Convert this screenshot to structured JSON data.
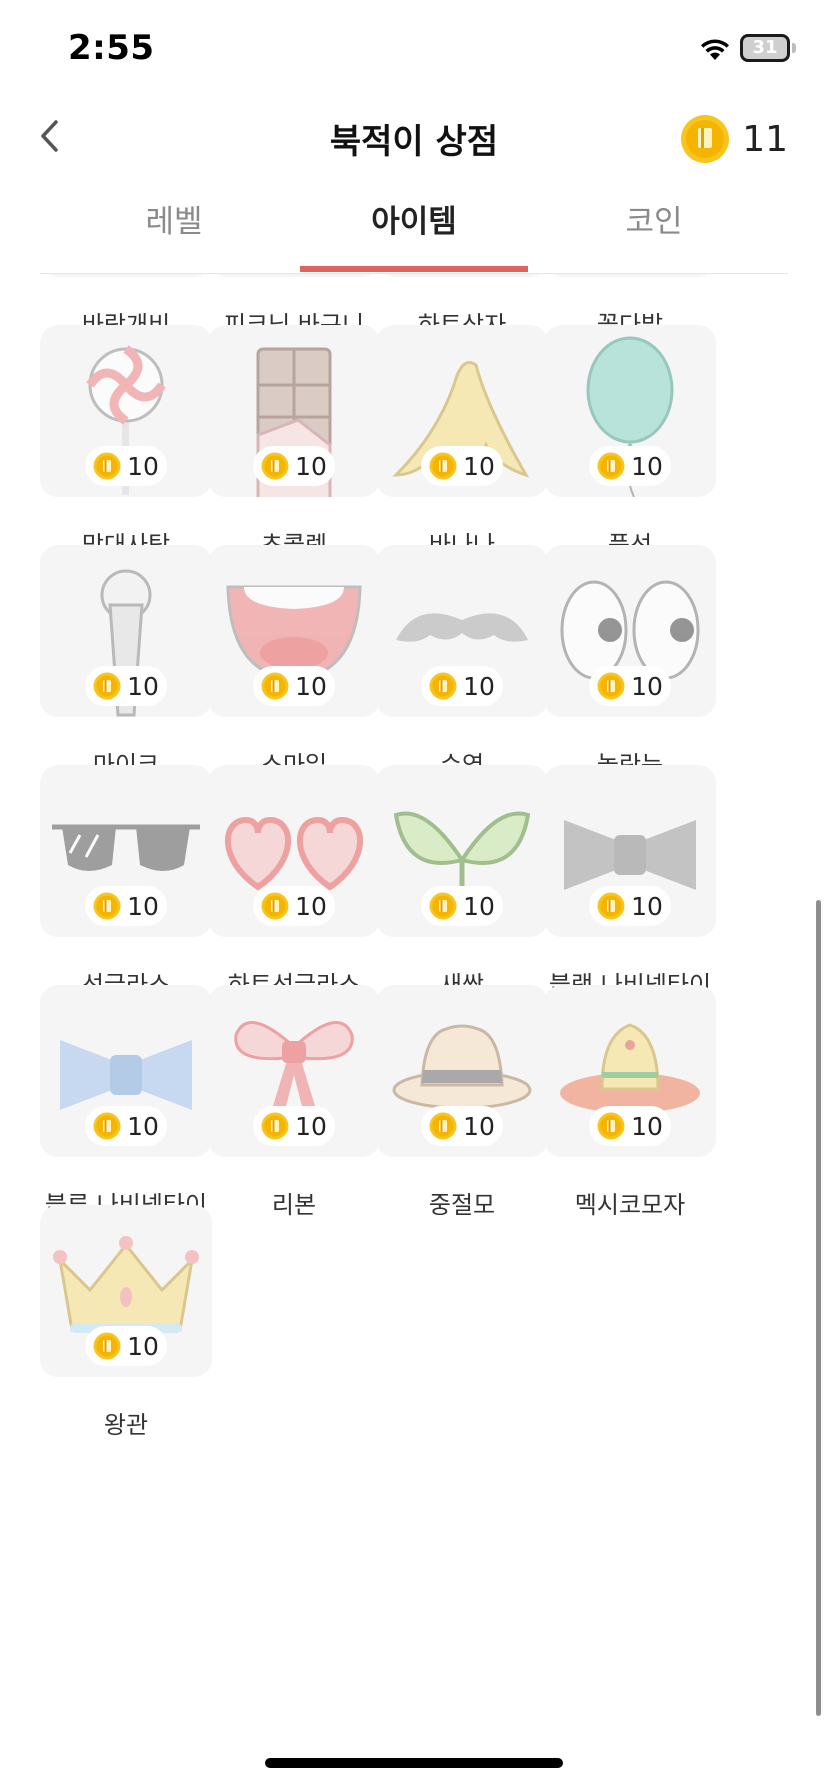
{
  "status_bar": {
    "time": "2:55",
    "battery": "31",
    "icons": [
      "wifi-icon",
      "battery-icon"
    ]
  },
  "nav": {
    "title": "북적이 상점",
    "back_icon": "chevron-left-icon",
    "coin_icon": "coin-icon",
    "coin_balance": "11"
  },
  "tabs": [
    {
      "label": "레벨",
      "selected": false
    },
    {
      "label": "아이템",
      "selected": true
    },
    {
      "label": "코인",
      "selected": false
    }
  ],
  "colors": {
    "accent": "#e0645e",
    "card_bg": "#f5f5f5",
    "coin": "#f5b800"
  },
  "items": [
    {
      "name": "바람개비",
      "price": "10",
      "icon": "pinwheel-icon"
    },
    {
      "name": "피크닉 바구니",
      "price": "10",
      "icon": "picnic-basket-icon"
    },
    {
      "name": "하트상자",
      "price": "10",
      "icon": "heart-box-icon"
    },
    {
      "name": "꽃다발",
      "price": "10",
      "icon": "bouquet-icon"
    },
    {
      "name": "막대사탕",
      "price": "10",
      "icon": "lollipop-icon"
    },
    {
      "name": "초콜렛",
      "price": "10",
      "icon": "chocolate-icon"
    },
    {
      "name": "바나나",
      "price": "10",
      "icon": "banana-icon"
    },
    {
      "name": "풍선",
      "price": "10",
      "icon": "balloon-icon"
    },
    {
      "name": "마이크",
      "price": "10",
      "icon": "microphone-icon"
    },
    {
      "name": "스마일",
      "price": "10",
      "icon": "smile-mouth-icon"
    },
    {
      "name": "수염",
      "price": "10",
      "icon": "mustache-icon"
    },
    {
      "name": "놀란눈",
      "price": "10",
      "icon": "surprised-eyes-icon"
    },
    {
      "name": "선글라스",
      "price": "10",
      "icon": "sunglasses-icon"
    },
    {
      "name": "하트선글라스",
      "price": "10",
      "icon": "heart-sunglasses-icon"
    },
    {
      "name": "새싹",
      "price": "10",
      "icon": "sprout-icon"
    },
    {
      "name": "블랙 나비넥타이",
      "price": "10",
      "icon": "black-bowtie-icon"
    },
    {
      "name": "블루 나비넥타이",
      "price": "10",
      "icon": "blue-bowtie-icon"
    },
    {
      "name": "리본",
      "price": "10",
      "icon": "ribbon-icon"
    },
    {
      "name": "중절모",
      "price": "10",
      "icon": "fedora-icon"
    },
    {
      "name": "멕시코모자",
      "price": "10",
      "icon": "sombrero-icon"
    },
    {
      "name": "왕관",
      "price": "10",
      "icon": "crown-icon"
    }
  ]
}
